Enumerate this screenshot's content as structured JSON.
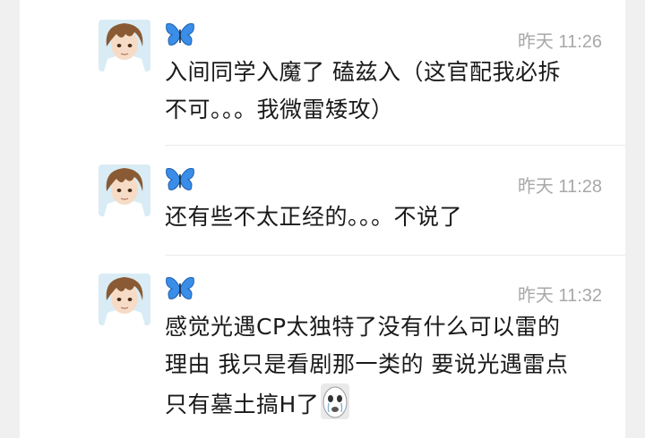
{
  "messages": [
    {
      "timestamp": "昨天 11:26",
      "lines": [
        "入间同学入魔了 磕兹入（这官配我必拆",
        "不可。。。我微雷矮攻）"
      ],
      "avatar_icon": "anime-boy-avatar",
      "name_icon": "blue-butterfly-icon"
    },
    {
      "timestamp": "昨天 11:28",
      "lines": [
        "还有些不太正经的。。。不说了"
      ],
      "avatar_icon": "anime-boy-avatar",
      "name_icon": "blue-butterfly-icon"
    },
    {
      "timestamp": "昨天 11:32",
      "lines": [
        "感觉光遇CP太独特了没有什么可以雷的",
        "理由 我只是看剧那一类的 要说光遇雷点",
        "只有墓土搞H了"
      ],
      "avatar_icon": "anime-boy-avatar",
      "name_icon": "blue-butterfly-icon",
      "sticker_icon": "crying-face-sticker"
    }
  ],
  "colors": {
    "background": "#f0f0f0",
    "card": "#ffffff",
    "text": "#1a1a1a",
    "timestamp": "#a8a8a8",
    "butterfly": "#3a8ee8"
  }
}
